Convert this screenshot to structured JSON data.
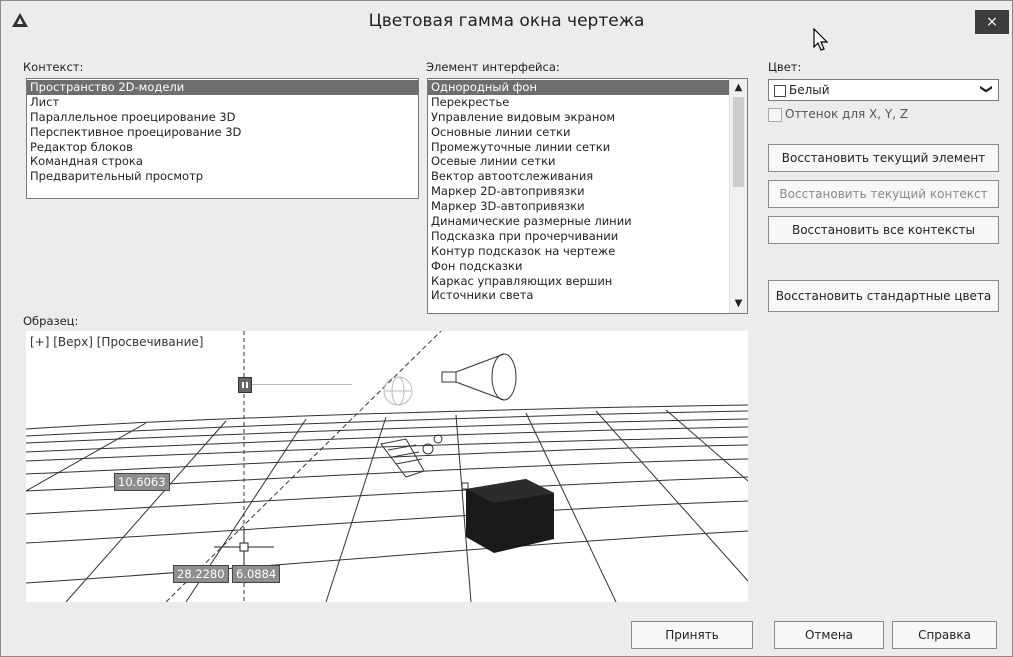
{
  "window": {
    "title": "Цветовая гамма окна чертежа",
    "close_glyph": "×",
    "app_icon": "autocad-triangle-icon"
  },
  "context": {
    "label": "Контекст:",
    "items": [
      {
        "label": "Пространство 2D-модели",
        "selected": true
      },
      {
        "label": "Лист",
        "selected": false
      },
      {
        "label": "Параллельное проецирование 3D",
        "selected": false
      },
      {
        "label": "Перспективное проецирование 3D",
        "selected": false
      },
      {
        "label": "Редактор блоков",
        "selected": false
      },
      {
        "label": "Командная строка",
        "selected": false
      },
      {
        "label": "Предварительный просмотр",
        "selected": false
      }
    ]
  },
  "element": {
    "label": "Элемент интерфейса:",
    "items": [
      {
        "label": "Однородный фон",
        "selected": true
      },
      {
        "label": "Перекрестье",
        "selected": false
      },
      {
        "label": "Управление видовым экраном",
        "selected": false
      },
      {
        "label": "Основные линии сетки",
        "selected": false
      },
      {
        "label": "Промежуточные линии сетки",
        "selected": false
      },
      {
        "label": "Осевые линии сетки",
        "selected": false
      },
      {
        "label": "Вектор автоотслеживания",
        "selected": false
      },
      {
        "label": "Маркер 2D-автопривязки",
        "selected": false
      },
      {
        "label": "Маркер 3D-автопривязки",
        "selected": false
      },
      {
        "label": "Динамические размерные линии",
        "selected": false
      },
      {
        "label": "Подсказка при прочерчивании",
        "selected": false
      },
      {
        "label": "Контур подсказок на чертеже",
        "selected": false
      },
      {
        "label": "Фон подсказки",
        "selected": false
      },
      {
        "label": "Каркас управляющих вершин",
        "selected": false
      },
      {
        "label": "Источники света",
        "selected": false
      }
    ],
    "scroll_up": "▲",
    "scroll_down": "▼"
  },
  "color": {
    "label": "Цвет:",
    "selected": "Белый",
    "swatch_color": "#ffffff",
    "arrow": "❯",
    "tint_label": "Оттенок для X, Y, Z",
    "tint_checked": false
  },
  "buttons": {
    "restore_element": "Восстановить текущий элемент",
    "restore_context": "Восстановить текущий контекст",
    "restore_all": "Восстановить все контексты",
    "restore_default": "Восстановить стандартные цвета",
    "accept": "Принять",
    "cancel": "Отмена",
    "help": "Справка"
  },
  "preview": {
    "label": "Образец:",
    "view_label": "[+] [Верх] [Просвечивание]",
    "coord_left": "10.6063",
    "coord_x": "28.2280",
    "coord_y": "6.0884",
    "background": "#ffffff",
    "cube_color": "#1a1a1a"
  }
}
